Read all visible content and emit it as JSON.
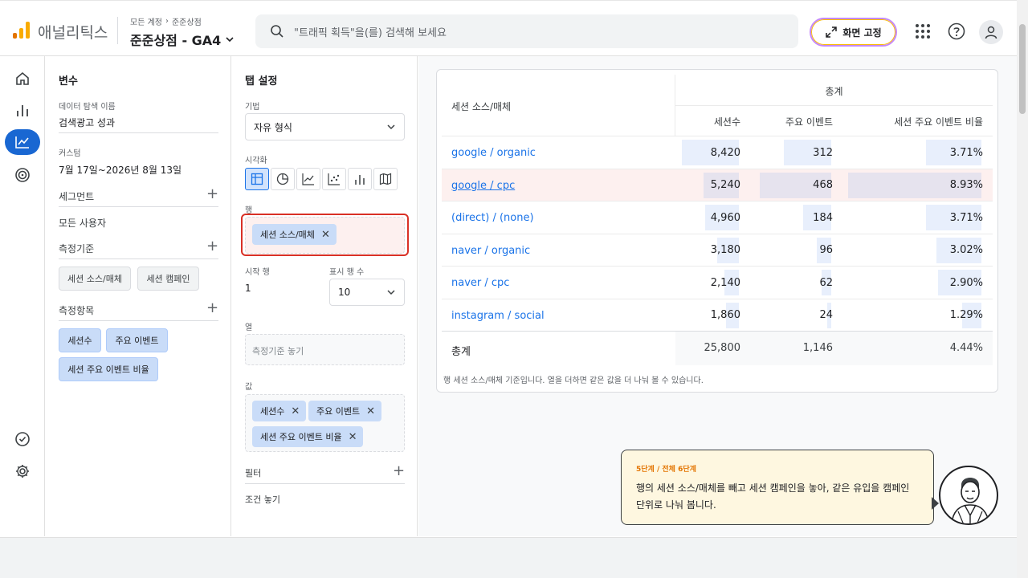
{
  "header": {
    "app_name": "애널리틱스",
    "breadcrumb": [
      "모든 계정",
      "준준상점"
    ],
    "property": "준준상점 - GA4",
    "search_placeholder": "\"트래픽 획득\"을(를) 검색해 보세요",
    "pin_label": "화면 고정",
    "icons": [
      "apps-icon",
      "help-icon",
      "account-icon"
    ]
  },
  "nav": {
    "items": [
      "home-icon",
      "reports-icon",
      "explore-icon",
      "advertising-icon",
      "check-icon",
      "settings-icon"
    ],
    "active": "explore-icon"
  },
  "variables": {
    "title": "변수",
    "name_label": "데이터 탐색 이름",
    "name_value": "검색광고 성과",
    "date_label": "커스텀",
    "date_value": "7월 17일~2026년 8월 13일",
    "segments_label": "세그먼트",
    "segment_value": "모든 사용자",
    "dimensions_label": "측정기준",
    "dimensions": [
      "세션 소스/매체",
      "세션 캠페인"
    ],
    "metrics_label": "측정항목",
    "metrics": [
      "세션수",
      "주요 이벤트",
      "세션 주요 이벤트 비율"
    ]
  },
  "tab_settings": {
    "title": "탭 설정",
    "technique_label": "기법",
    "technique_value": "자유 형식",
    "viz_label": "시각화",
    "rows_label": "행",
    "row_chip": "세션 소스/매체",
    "start_row_label": "시작 행",
    "start_row_value": "1",
    "show_rows_label": "표시 행 수",
    "show_rows_value": "10",
    "columns_label": "열",
    "columns_placeholder": "측정기준 놓기",
    "values_label": "값",
    "value_chips": [
      "세션수",
      "주요 이벤트",
      "세션 주요 이벤트 비율"
    ],
    "filters_label": "필터",
    "filters_placeholder": "조건 놓기"
  },
  "table": {
    "row_header": "세션 소스/매체",
    "group_header": "총계",
    "columns": [
      "세션수",
      "주요 이벤트",
      "세션 주요 이벤트 비율"
    ],
    "rows": [
      {
        "source": "google / organic",
        "sessions": "8,420",
        "events": "312",
        "rate": "3.71%"
      },
      {
        "source": "google / cpc",
        "sessions": "5,240",
        "events": "468",
        "rate": "8.93%"
      },
      {
        "source": "(direct) / (none)",
        "sessions": "4,960",
        "events": "184",
        "rate": "3.71%"
      },
      {
        "source": "naver / organic",
        "sessions": "3,180",
        "events": "96",
        "rate": "3.02%"
      },
      {
        "source": "naver / cpc",
        "sessions": "2,140",
        "events": "62",
        "rate": "2.90%"
      },
      {
        "source": "instagram / social",
        "sessions": "1,860",
        "events": "24",
        "rate": "1.29%"
      }
    ],
    "total_label": "총계",
    "total": {
      "sessions": "25,800",
      "events": "1,146",
      "rate": "4.44%"
    },
    "footnote": "행 세션 소스/매체 기준입니다. 열을 더하면 같은 값을 더 나눠 볼 수 있습니다."
  },
  "tip": {
    "step": "5단계 / 전체 6단계",
    "message": "행의 세션 소스/매체를 빼고 세션 캠페인을 놓아, 같은 유입을 캠페인 단위로 나눠 봅니다."
  },
  "colors": {
    "accent": "#1a73e8",
    "highlight": "#d93025",
    "tip_bg": "#fef7e0"
  }
}
